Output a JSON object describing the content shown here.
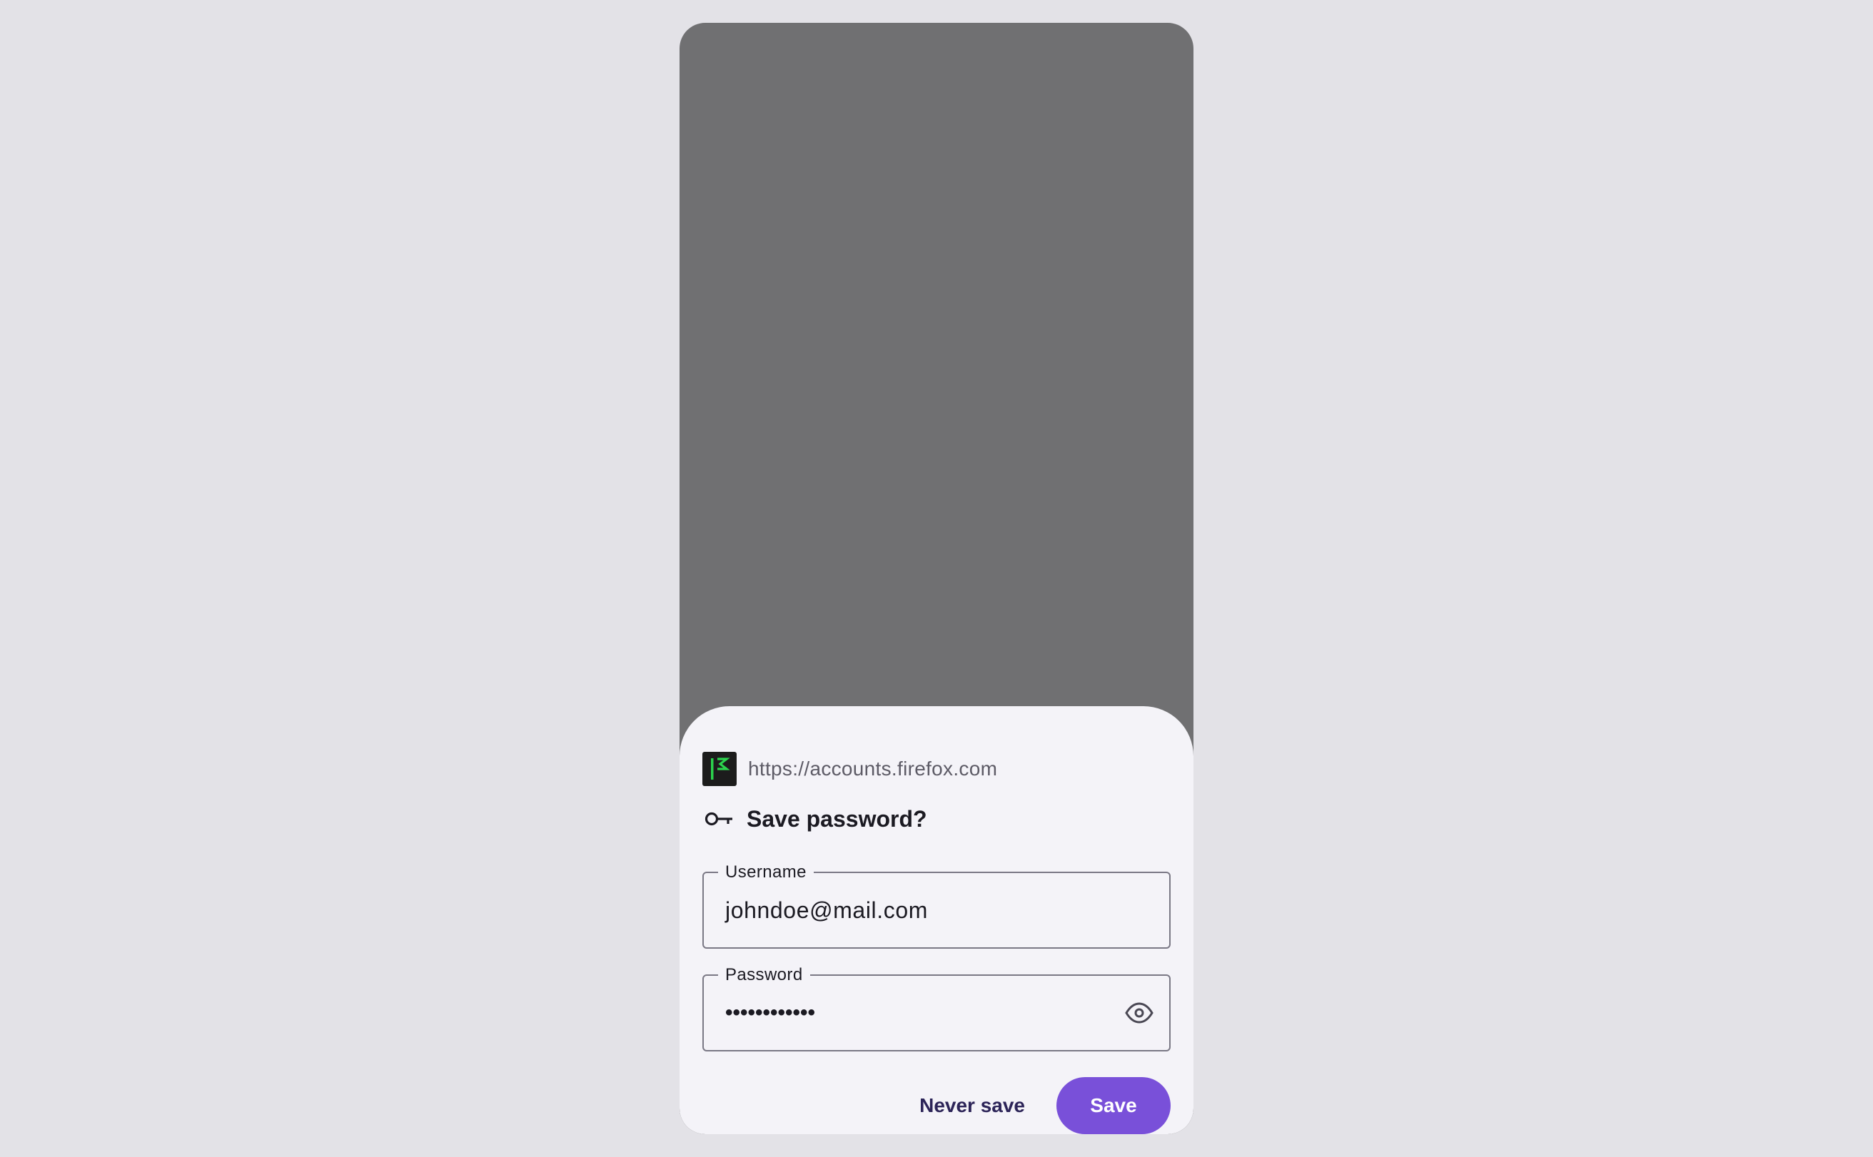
{
  "prompt": {
    "origin_url": "https://accounts.firefox.com",
    "title": "Save password?",
    "favicon_icon": "firefox-accounts-favicon",
    "title_icon": "key-icon"
  },
  "fields": {
    "username": {
      "label": "Username",
      "value": "johndoe@mail.com"
    },
    "password": {
      "label": "Password",
      "value": "••••••••••••",
      "reveal_icon": "eye-icon"
    }
  },
  "actions": {
    "never_save_label": "Never save",
    "save_label": "Save"
  },
  "colors": {
    "accent": "#7950d9",
    "scrim": "#707072",
    "sheet": "#f4f3f8",
    "favicon_green": "#2bd24d"
  }
}
